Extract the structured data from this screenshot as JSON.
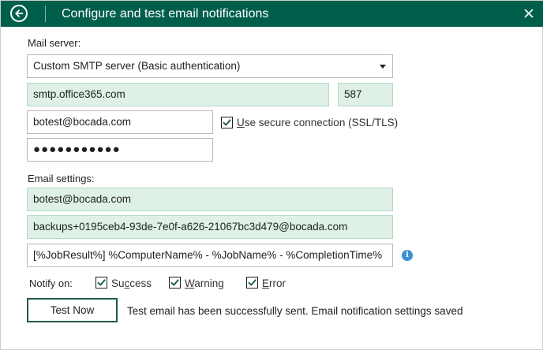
{
  "window": {
    "title": "Configure and test email notifications"
  },
  "mail_server": {
    "section_label": "Mail server:",
    "server_type": "Custom SMTP server (Basic authentication)",
    "host": "smtp.office365.com",
    "port": "587",
    "username": "botest@bocada.com",
    "password": "●●●●●●●●●●●",
    "secure_connection": {
      "checked": true,
      "label_mnemonic": "U",
      "label_rest": "se secure connection (SSL/TLS)"
    }
  },
  "email_settings": {
    "section_label": "Email settings:",
    "from": "botest@bocada.com",
    "to": "backups+0195ceb4-93de-7e0f-a626-21067bc3d479@bocada.com",
    "subject": "[%JobResult%] %ComputerName% - %JobName% - %CompletionTime%"
  },
  "notify": {
    "label": "Notify on:",
    "options": [
      {
        "name": "success",
        "checked": true,
        "pre": "Su",
        "mnemonic": "c",
        "post": "cess"
      },
      {
        "name": "warning",
        "checked": true,
        "pre": "",
        "mnemonic": "W",
        "post": "arning"
      },
      {
        "name": "error",
        "checked": true,
        "pre": "",
        "mnemonic": "E",
        "post": "rror"
      }
    ]
  },
  "actions": {
    "test_button": "Test Now",
    "status": "Test email has been successfully sent. Email notification settings saved"
  },
  "colors": {
    "titlebar": "#005f4b",
    "filled_field": "#dff1e7",
    "info": "#3b8fd6"
  },
  "icons": {
    "back": "back-arrow-icon",
    "close": "close-icon",
    "checkbox": "checkmark-icon",
    "info": "info-icon",
    "dropdown": "chevron-down-icon"
  }
}
